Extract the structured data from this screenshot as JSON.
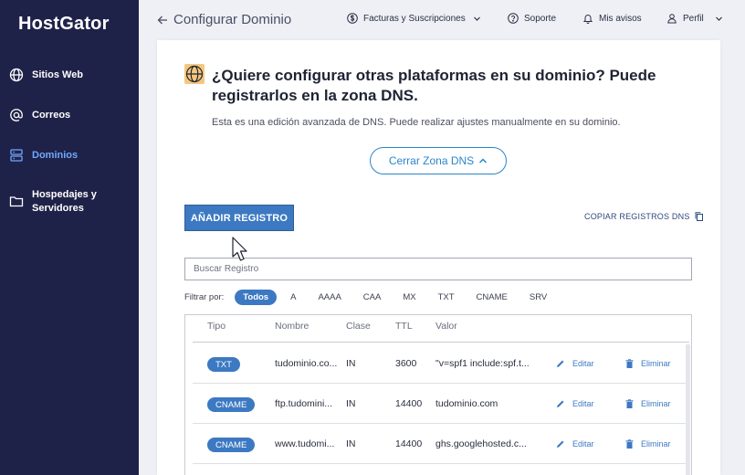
{
  "sidebar": {
    "logo": "HostGator",
    "items": [
      {
        "label": "Sitios Web",
        "icon": "globe-icon"
      },
      {
        "label": "Correos",
        "icon": "at-icon"
      },
      {
        "label": "Dominios",
        "icon": "server-icon",
        "active": true
      },
      {
        "label": "Hospedajes y Servidores",
        "icon": "folder-icon"
      }
    ]
  },
  "header": {
    "back_label": "Configurar Dominio",
    "billing": "Facturas y Suscripciones",
    "support": "Soporte",
    "notices": "Mis avisos",
    "profile": "Perfil"
  },
  "main": {
    "heading": "¿Quiere configurar otras plataformas en su dominio? Puede registrarlos en la zona DNS.",
    "subtext": "Esta es una edición avanzada de DNS. Puede realizar ajustes manualmente en su dominio.",
    "close_dns_label": "Cerrar Zona DNS",
    "add_record_label": "AÑADIR REGISTRO",
    "copy_records_label": "COPIAR REGISTROS DNS",
    "search_placeholder": "Buscar Registro",
    "filter_label": "Filtrar por:",
    "filters": [
      "Todos",
      "A",
      "AAAA",
      "CAA",
      "MX",
      "TXT",
      "CNAME",
      "SRV"
    ],
    "active_filter": "Todos"
  },
  "table": {
    "columns": [
      "Tipo",
      "Nombre",
      "Clase",
      "TTL",
      "Valor"
    ],
    "edit_label": "Editar",
    "delete_label": "Eliminar",
    "rows": [
      {
        "type": "TXT",
        "name": "tudominio.co...",
        "class": "IN",
        "ttl": "3600",
        "value": "\"v=spf1 include:spf.t..."
      },
      {
        "type": "CNAME",
        "name": "ftp.tudomini...",
        "class": "IN",
        "ttl": "14400",
        "value": "tudominio.com"
      },
      {
        "type": "CNAME",
        "name": "www.tudomi...",
        "class": "IN",
        "ttl": "14400",
        "value": "ghs.googlehosted.c..."
      }
    ]
  },
  "colors": {
    "sidebar_bg": "#1f2248",
    "accent": "#3c79c2",
    "active_nav": "#6fa8ff",
    "outline_button": "#2a86c9",
    "globe_badge": "#f4c77e"
  }
}
